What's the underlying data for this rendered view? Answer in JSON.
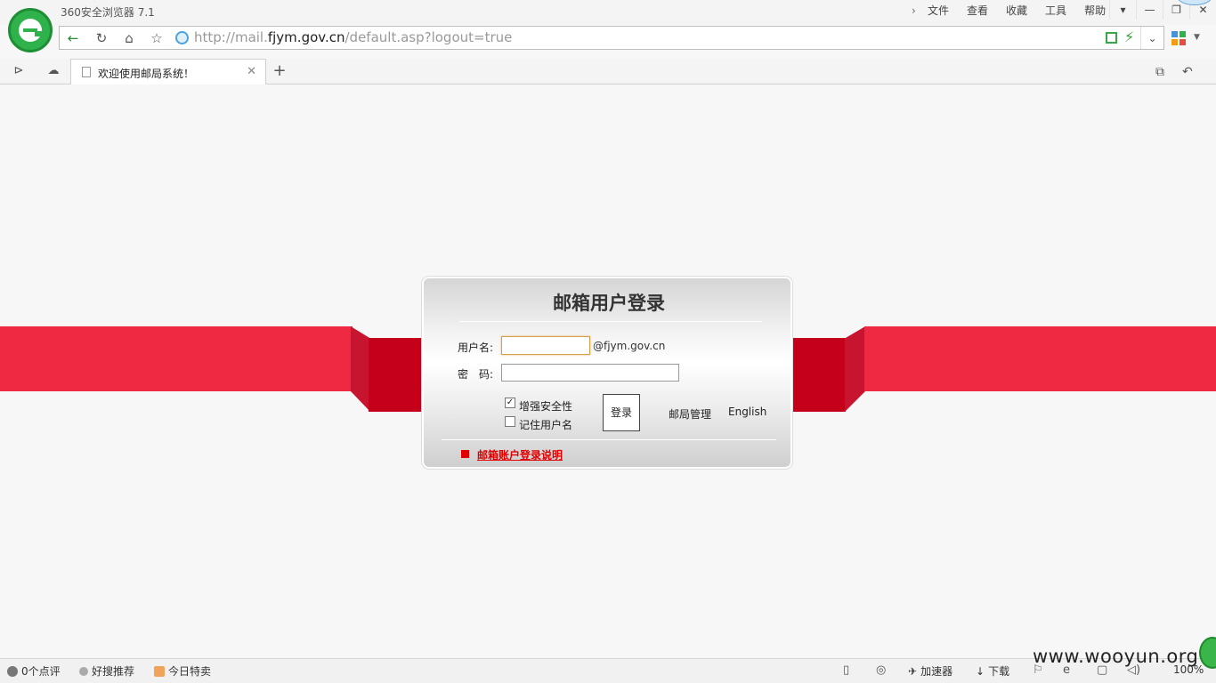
{
  "browser": {
    "app_title": "360安全浏览器 7.1",
    "menu": [
      "文件",
      "查看",
      "收藏",
      "工具",
      "帮助"
    ],
    "url_prefix": "http://mail.",
    "url_host": "fjym.gov.cn",
    "url_suffix": "/default.asp?logout=true",
    "tab_title": "欢迎使用邮局系统！",
    "icons": {
      "back": "arrow-left-icon",
      "refresh": "refresh-icon",
      "home": "home-icon",
      "favorite": "star-icon"
    }
  },
  "login": {
    "title": "邮箱用户登录",
    "username_label": "用户名:",
    "username_value": "",
    "domain": "@fjym.gov.cn",
    "password_label": "密　码:",
    "password_value": "",
    "enhance_security_label": "增强安全性",
    "enhance_security_checked": true,
    "remember_label": "记住用户名",
    "remember_checked": false,
    "submit_label": "登录",
    "admin_link": "邮局管理",
    "english_link": "English",
    "help_link": "邮箱账户登录说明"
  },
  "statusbar": {
    "reviews": "0个点评",
    "recommend": "好搜推荐",
    "deals": "今日特卖",
    "accelerator": "加速器",
    "download": "下载",
    "zoom": "100%"
  },
  "watermark": "www.wooyun.org",
  "colors": {
    "ribbon": "#ee2941",
    "ribbon_dark": "#c4001a",
    "help_link": "#e00000",
    "brand_green": "#2fb24c"
  }
}
